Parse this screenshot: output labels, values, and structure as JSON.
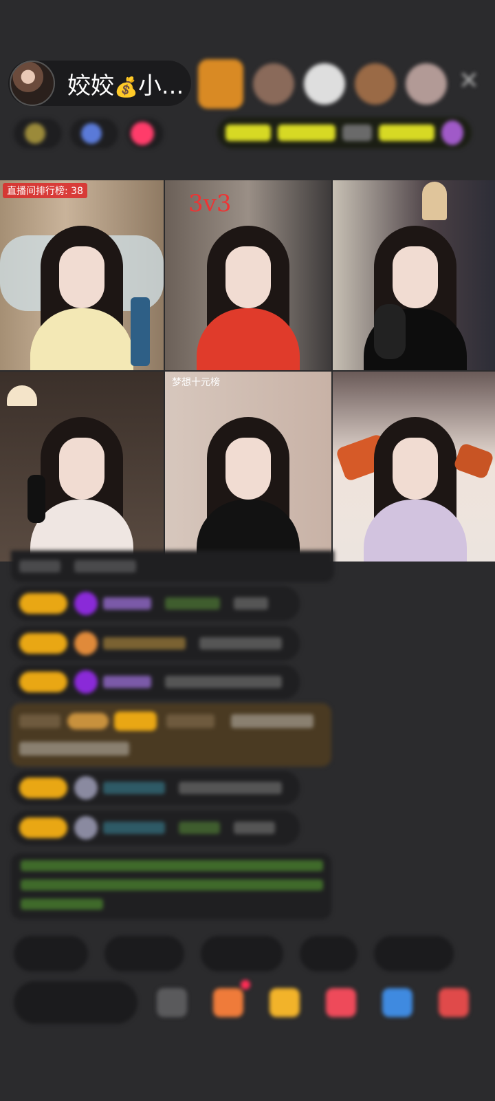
{
  "header": {
    "host_name": "姣姣",
    "host_name_suffix": "小...",
    "host_icon": "money-bag-icon",
    "viewers_count": 5
  },
  "close_icon": "close-icon",
  "tiles": [
    {
      "tag": "直播间排行榜: 38",
      "vs_label": ""
    },
    {
      "tag": "",
      "vs_label": "3v3"
    },
    {
      "tag": "",
      "vs_label": ""
    },
    {
      "tag": "",
      "vs_label": ""
    },
    {
      "tag": "梦想十元榜",
      "vs_label": ""
    },
    {
      "tag": "",
      "vs_label": ""
    }
  ],
  "bottom_pills": [
    "",
    "",
    "",
    "",
    "",
    ""
  ],
  "say_placeholder": "",
  "colors": {
    "background": "#2b2b2d",
    "badge": "#e9a714",
    "system_text": "#6fae3e"
  }
}
